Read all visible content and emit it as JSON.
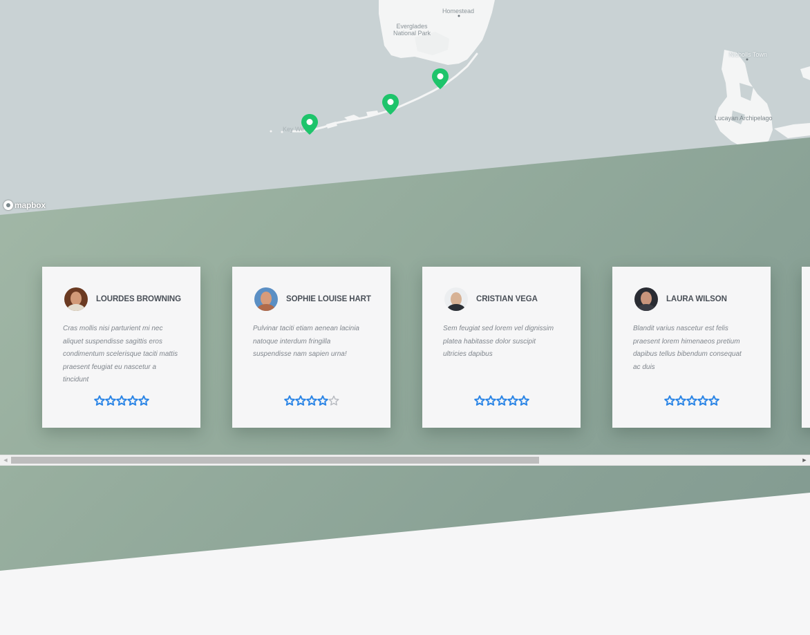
{
  "map": {
    "labels": {
      "homestead": "Homestead",
      "everglades": "Everglades\nNational Park",
      "nichols_town": "Nicholls Town",
      "lucayan": "Lucayan Archipelago",
      "key_west": "Key West"
    },
    "attribution": "mapbox",
    "pin_color": "#1ec46b",
    "water_color": "#c9d2d4",
    "land_color": "#f4f5f5"
  },
  "testimonials": [
    {
      "name": "LOURDES BROWNING",
      "quote": "Cras mollis nisi parturient mi nec aliquet suspendisse sagittis eros condimentum scelerisque taciti mattis praesent feugiat eu nascetur a tincidunt",
      "rating": 5
    },
    {
      "name": "SOPHIE LOUISE HART",
      "quote": "Pulvinar taciti etiam aenean lacinia natoque interdum fringilla suspendisse nam sapien urna!",
      "rating": 4
    },
    {
      "name": "CRISTIAN VEGA",
      "quote": "Sem feugiat sed lorem vel dignissim platea habitasse dolor suscipit ultricies dapibus",
      "rating": 5
    },
    {
      "name": "LAURA WILSON",
      "quote": "Blandit varius nascetur est felis praesent lorem himenaeos pretium dapibus tellus bibendum consequat ac duis",
      "rating": 5
    }
  ],
  "scrollbar": {
    "position_fraction": 0.0,
    "visible_fraction": 0.67
  },
  "colors": {
    "star": "#2d86e6",
    "green_band": "#98af9f"
  }
}
